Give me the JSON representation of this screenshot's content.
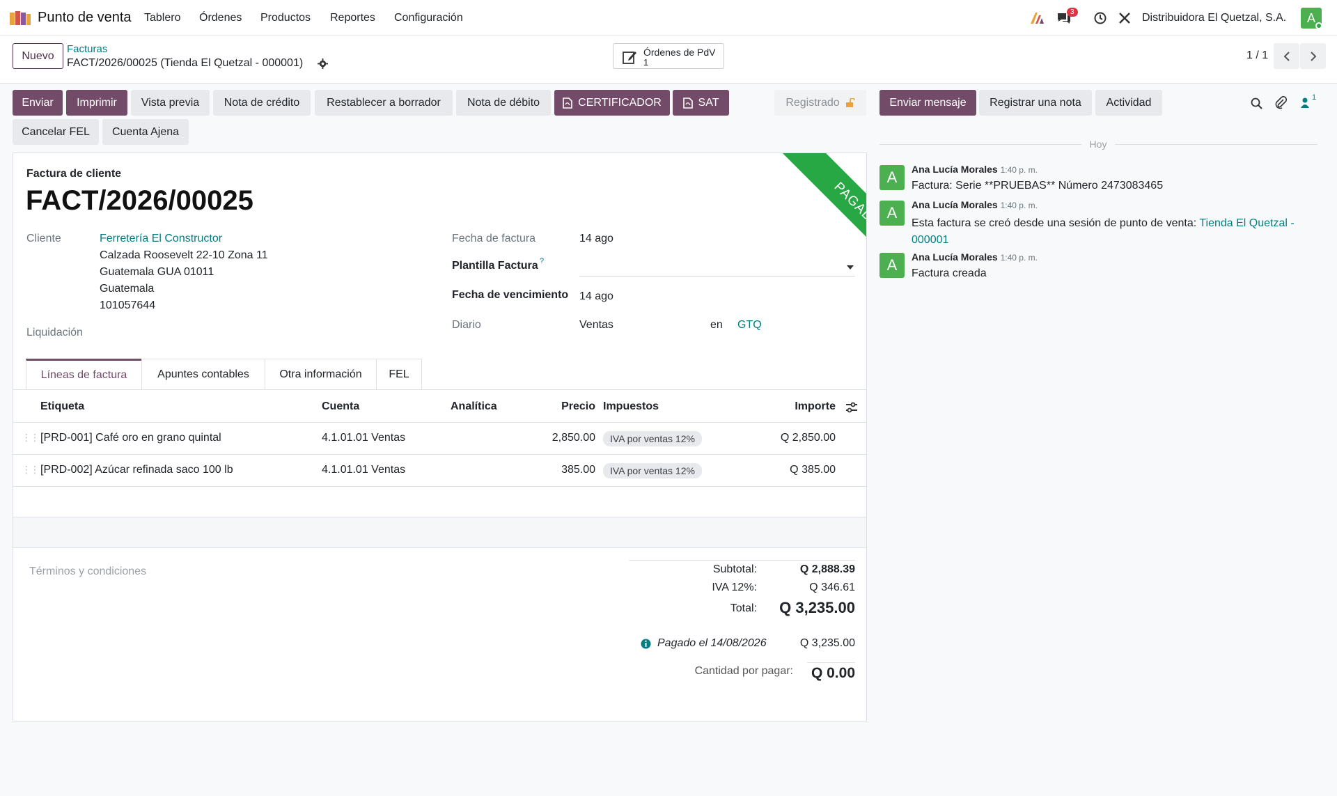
{
  "navbar": {
    "app_name": "Punto de venta",
    "menus": [
      "Tablero",
      "Órdenes",
      "Productos",
      "Reportes",
      "Configuración"
    ],
    "chat_badge": "3",
    "company": "Distribuidora El Quetzal, S.A.",
    "user_initial": "A"
  },
  "control": {
    "new_label": "Nuevo",
    "breadcrumb_parent": "Facturas",
    "breadcrumb_current": "FACT/2026/00025 (Tienda El Quetzal - 000001)",
    "smart_button_label": "Órdenes de PdV",
    "smart_button_count": "1",
    "pager": "1 / 1"
  },
  "actions": {
    "row1": [
      "Enviar",
      "Imprimir",
      "Vista previa",
      "Nota de crédito",
      "Restablecer a borrador",
      "Nota de débito",
      "CERTIFICADOR",
      "SAT"
    ],
    "row2": [
      "Cancelar FEL",
      "Cuenta Ajena"
    ],
    "status": "Registrado"
  },
  "chatter_buttons": {
    "send": "Enviar mensaje",
    "note": "Registrar una nota",
    "activity": "Actividad",
    "followers": "1"
  },
  "form": {
    "doc_type": "Factura de cliente",
    "number": "FACT/2026/00025",
    "ribbon": "PAGADO",
    "customer_label": "Cliente",
    "customer_name": "Ferretería El Constructor",
    "address": [
      "Calzada Roosevelt 22-10 Zona 11",
      "Guatemala GUA 01011",
      "Guatemala",
      "101057644"
    ],
    "liquidacion_label": "Liquidación",
    "invoice_date_label": "Fecha de factura",
    "invoice_date": "14 ago",
    "template_label": "Plantilla Factura",
    "template_help": "?",
    "due_date_label": "Fecha de vencimiento",
    "due_date": "14 ago",
    "journal_label": "Diario",
    "journal": "Ventas",
    "currency_prefix": "en",
    "currency": "GTQ"
  },
  "tabs": [
    "Líneas de factura",
    "Apuntes contables",
    "Otra información",
    "FEL"
  ],
  "table": {
    "headers": {
      "label": "Etiqueta",
      "account": "Cuenta",
      "analytic": "Analítica",
      "price": "Precio",
      "taxes": "Impuestos",
      "amount": "Importe"
    },
    "rows": [
      {
        "label": "[PRD-001] Café oro en grano quintal",
        "account": "4.1.01.01 Ventas",
        "price": "2,850.00",
        "tax": "IVA por ventas 12%",
        "amount": "Q 2,850.00"
      },
      {
        "label": "[PRD-002] Azúcar refinada saco 100 lb",
        "account": "4.1.01.01 Ventas",
        "price": "385.00",
        "tax": "IVA por ventas 12%",
        "amount": "Q 385.00"
      }
    ]
  },
  "totals": {
    "terms_placeholder": "Términos y condiciones",
    "subtotal_label": "Subtotal:",
    "subtotal": "Q 2,888.39",
    "iva_label": "IVA 12%:",
    "iva": "Q 346.61",
    "total_label": "Total:",
    "total": "Q 3,235.00",
    "paid_label": "Pagado el 14/08/2026",
    "paid_amount": "Q 3,235.00",
    "due_label": "Cantidad por pagar:",
    "due": "Q 0.00"
  },
  "chatter": {
    "date_sep": "Hoy",
    "messages": [
      {
        "author": "Ana Lucía Morales",
        "time": "1:40 p. m.",
        "body": "Factura: Serie **PRUEBAS** Número 2473083465"
      },
      {
        "author": "Ana Lucía Morales",
        "time": "1:40 p. m.",
        "body": "Esta factura se creó desde una sesión de punto de venta: ",
        "link": "Tienda El Quetzal - 000001"
      },
      {
        "author": "Ana Lucía Morales",
        "time": "1:40 p. m.",
        "body": "Factura creada"
      }
    ]
  },
  "colors": {
    "brand": "#714b67",
    "link": "#017e84",
    "paid": "#28a745"
  }
}
